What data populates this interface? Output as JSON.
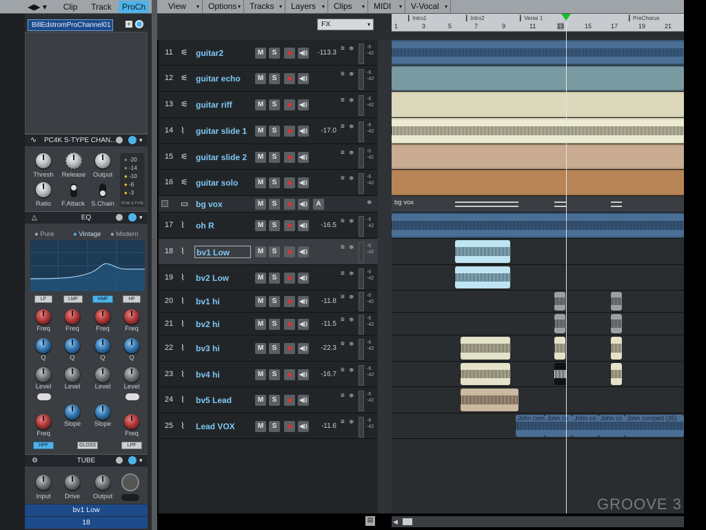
{
  "left_tabs": {
    "clip": "Clip",
    "track": "Track",
    "proch": "ProCh"
  },
  "channel_name": "BillEdstromProChannel01",
  "compressor": {
    "title": "PC4K S-TYPE CHAN...",
    "thresh": "Thresh",
    "release": "Release",
    "output": "Output",
    "ratio": "Ratio",
    "fattack": "F.Attack",
    "schain": "S.Chain",
    "meter_values": [
      "-20",
      "-14",
      "-10",
      "-6",
      "-3"
    ],
    "brand": "PC4K S-TYPE"
  },
  "eq": {
    "title": "EQ",
    "modes": [
      "Pure",
      "Vintage",
      "Modern"
    ],
    "bands": [
      "LF",
      "LMF",
      "HMF",
      "HF"
    ],
    "freq": "Freq",
    "q": "Q",
    "level": "Level",
    "slope": "Slope",
    "hpf": "HPF",
    "gloss": "GLOSS",
    "lpf": "LPF"
  },
  "tube": {
    "title": "TUBE",
    "input": "Input",
    "drive": "Drive",
    "output": "Output"
  },
  "selected_track": {
    "name": "bv1 Low",
    "number": "18"
  },
  "menus": [
    "View",
    "Options",
    "Tracks",
    "Layers",
    "Clips",
    "MIDI",
    "V-Vocal"
  ],
  "fx_select": "FX",
  "ruler": {
    "markers": [
      "Intro1",
      "Intro2",
      "Verse 1",
      "PreChorus"
    ],
    "numbers": [
      "1",
      "3",
      "5",
      "7",
      "9",
      "11",
      "13",
      "15",
      "17",
      "19",
      "21"
    ]
  },
  "tracks": [
    {
      "num": "11",
      "name": "guitar2",
      "vol": "-113.3",
      "icon": "synth-icon"
    },
    {
      "num": "12",
      "name": "guitar echo",
      "vol": "",
      "icon": "synth-icon"
    },
    {
      "num": "13",
      "name": "guitar riff",
      "vol": "",
      "icon": "synth-icon"
    },
    {
      "num": "14",
      "name": "guitar slide 1",
      "vol": "-17.0",
      "icon": "audio-icon"
    },
    {
      "num": "15",
      "name": "guitar slide 2",
      "vol": "",
      "icon": "synth-icon"
    },
    {
      "num": "16",
      "name": "guitar solo",
      "vol": "",
      "icon": "synth-icon"
    },
    {
      "num": "",
      "name": "bg vox",
      "vol": "",
      "icon": "folder-icon"
    },
    {
      "num": "17",
      "name": "oh R",
      "vol": "-16.5",
      "icon": "audio-icon"
    },
    {
      "num": "18",
      "name": "bv1 Low",
      "vol": "",
      "icon": "audio-icon"
    },
    {
      "num": "19",
      "name": "bv2 Low",
      "vol": "",
      "icon": "audio-icon"
    },
    {
      "num": "20",
      "name": "bv1 hi",
      "vol": "-11.8",
      "icon": "audio-icon"
    },
    {
      "num": "21",
      "name": "bv2 hi",
      "vol": "-11.5",
      "icon": "audio-icon"
    },
    {
      "num": "22",
      "name": "bv3  hi",
      "vol": "-22.3",
      "icon": "audio-icon"
    },
    {
      "num": "23",
      "name": "bv4 hi",
      "vol": "-16.7",
      "icon": "audio-icon"
    },
    {
      "num": "24",
      "name": "bv5 Lead",
      "vol": "",
      "icon": "audio-icon"
    },
    {
      "num": "25",
      "name": "Lead VOX",
      "vol": "-11.6",
      "icon": "audio-icon"
    }
  ],
  "button_labels": {
    "mute": "M",
    "solo": "S",
    "auto": "A"
  },
  "meter_labels": {
    "top": "-6",
    "bottom": "-42"
  },
  "folder_clip_label": "bg vox",
  "lead_clips": [
    "John comp",
    "John co",
    "John co",
    "John co",
    "John comped (35)"
  ],
  "watermark": "GROOVE 3",
  "colors": {
    "accent": "#4fb2e8",
    "track_name": "#7ec8f4",
    "record": "#d93333",
    "playhead_marker": "#18c030"
  }
}
